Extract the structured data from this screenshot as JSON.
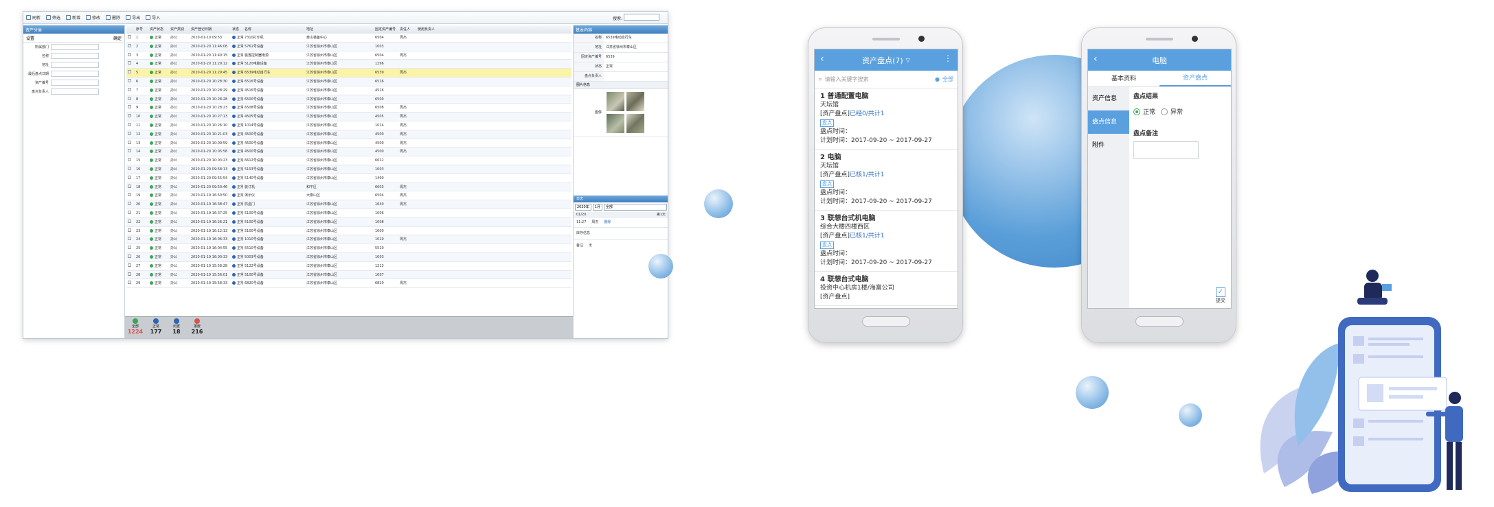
{
  "desktop": {
    "toolbar": [
      "刷新",
      "筛选",
      "新增",
      "修改",
      "删除",
      "导出",
      "导入"
    ],
    "search_label": "搜索:",
    "left_panel": {
      "title": "资产分类",
      "settings_label": "设置",
      "confirm_label": "确定",
      "fields": [
        "所属部门",
        "名称",
        "地址",
        "最后盘点日期",
        "资产编号",
        "盘点负责人"
      ]
    },
    "grid": {
      "headers": [
        "序号",
        "资产状态",
        "资产类别",
        "资产登记日期",
        "状态",
        "名称",
        "地址",
        "固定资产编号",
        "责任人",
        "使用负责人"
      ],
      "rows": [
        {
          "n": "1",
          "s": "正常",
          "c": "办公",
          "d": "2020-01-10 09:53",
          "st": "正常",
          "name": "7310打印机",
          "addr": "泰山装备中心",
          "code": "6504",
          "p": "周杰"
        },
        {
          "n": "2",
          "s": "正常",
          "c": "办公",
          "d": "2020-01-20 11:46:08",
          "st": "正常",
          "name": "5761号设备",
          "addr": "江苏省徐州市泰山区",
          "code": "1003",
          "p": ""
        },
        {
          "n": "3",
          "s": "正常",
          "c": "办公",
          "d": "2020-01-20 11:40:15",
          "st": "正常",
          "name": "装置控制器电源",
          "addr": "江苏省徐州市泰山区",
          "code": "6504",
          "p": "周杰"
        },
        {
          "n": "4",
          "s": "正常",
          "c": "办公",
          "d": "2020-01-20 11:29:12",
          "st": "正常",
          "name": "5120电脑设备",
          "addr": "江苏省徐州市泰山区",
          "code": "1296",
          "p": ""
        },
        {
          "n": "5",
          "s": "正常",
          "c": "办公",
          "d": "2020-01-20 11:29:45",
          "st": "正常",
          "name": "6539电动自行车",
          "addr": "江苏省徐州市泰山区",
          "code": "6539",
          "p": "周杰"
        },
        {
          "n": "6",
          "s": "正常",
          "c": "办公",
          "d": "2020-01-20 10:28:30",
          "st": "正常",
          "name": "6516号设备",
          "addr": "江苏省徐州市泰山区",
          "code": "6516",
          "p": ""
        },
        {
          "n": "7",
          "s": "正常",
          "c": "办公",
          "d": "2020-01-20 10:28:29",
          "st": "正常",
          "name": "4516号设备",
          "addr": "江苏省徐州市泰山区",
          "code": "4516",
          "p": ""
        },
        {
          "n": "8",
          "s": "正常",
          "c": "办公",
          "d": "2020-01-20 10:28:28",
          "st": "正常",
          "name": "6500号设备",
          "addr": "江苏省徐州市泰山区",
          "code": "6500",
          "p": ""
        },
        {
          "n": "9",
          "s": "正常",
          "c": "办公",
          "d": "2020-01-20 10:28:23",
          "st": "正常",
          "name": "6508号设备",
          "addr": "江苏省徐州市泰山区",
          "code": "6508",
          "p": "周杰"
        },
        {
          "n": "10",
          "s": "正常",
          "c": "办公",
          "d": "2020-01-20 10:27:13",
          "st": "正常",
          "name": "4505号设备",
          "addr": "江苏省徐州市泰山区",
          "code": "4505",
          "p": "周杰"
        },
        {
          "n": "11",
          "s": "正常",
          "c": "办公",
          "d": "2020-01-20 10:26:10",
          "st": "正常",
          "name": "1014号设备",
          "addr": "江苏省徐州市泰山区",
          "code": "1014",
          "p": "周杰"
        },
        {
          "n": "12",
          "s": "正常",
          "c": "办公",
          "d": "2020-01-20 10:21:03",
          "st": "正常",
          "name": "4500号设备",
          "addr": "江苏省徐州市泰山区",
          "code": "4500",
          "p": "周杰"
        },
        {
          "n": "13",
          "s": "正常",
          "c": "办公",
          "d": "2020-01-20 10:09:59",
          "st": "正常",
          "name": "4500号设备",
          "addr": "江苏省徐州市泰山区",
          "code": "4500",
          "p": "周杰"
        },
        {
          "n": "14",
          "s": "正常",
          "c": "办公",
          "d": "2020-01-20 10:05:58",
          "st": "正常",
          "name": "4500号设备",
          "addr": "江苏省徐州市泰山区",
          "code": "4500",
          "p": "周杰"
        },
        {
          "n": "15",
          "s": "正常",
          "c": "办公",
          "d": "2020-01-20 10:03:23",
          "st": "正常",
          "name": "6612号设备",
          "addr": "江苏省徐州市泰山区",
          "code": "6612",
          "p": ""
        },
        {
          "n": "16",
          "s": "正常",
          "c": "办公",
          "d": "2020-01-20 09:58:13",
          "st": "正常",
          "name": "5103号设备",
          "addr": "江苏省徐州市泰山区",
          "code": "1003",
          "p": ""
        },
        {
          "n": "17",
          "s": "正常",
          "c": "办公",
          "d": "2020-01-20 09:55:54",
          "st": "正常",
          "name": "5140号设备",
          "addr": "江苏省徐州市泰山区",
          "code": "1490",
          "p": ""
        },
        {
          "n": "18",
          "s": "正常",
          "c": "办公",
          "d": "2020-01-20 09:50:46",
          "st": "正常",
          "name": "装订机",
          "addr": "和平区",
          "code": "6603",
          "p": "周杰"
        },
        {
          "n": "19",
          "s": "正常",
          "c": "办公",
          "d": "2020-01-19 16:50:50",
          "st": "正常",
          "name": "演示仪",
          "addr": "大泰山区",
          "code": "6504",
          "p": "周杰"
        },
        {
          "n": "20",
          "s": "正常",
          "c": "办公",
          "d": "2020-01-19 16:38:47",
          "st": "正常",
          "name": "防盗门",
          "addr": "江苏省徐州市泰山区",
          "code": "1640",
          "p": "周杰"
        },
        {
          "n": "21",
          "s": "正常",
          "c": "办公",
          "d": "2020-01-19 16:37:25",
          "st": "正常",
          "name": "5100号设备",
          "addr": "江苏省徐州市泰山区",
          "code": "1006",
          "p": ""
        },
        {
          "n": "22",
          "s": "正常",
          "c": "办公",
          "d": "2020-01-19 16:26:21",
          "st": "正常",
          "name": "5100号设备",
          "addr": "江苏省徐州市泰山区",
          "code": "1008",
          "p": ""
        },
        {
          "n": "23",
          "s": "正常",
          "c": "办公",
          "d": "2020-01-19 16:12:13",
          "st": "正常",
          "name": "5100号设备",
          "addr": "江苏省徐州市泰山区",
          "code": "1000",
          "p": ""
        },
        {
          "n": "24",
          "s": "正常",
          "c": "办公",
          "d": "2020-01-19 16:06:33",
          "st": "正常",
          "name": "1010号设备",
          "addr": "江苏省徐州市泰山区",
          "code": "1010",
          "p": "周杰"
        },
        {
          "n": "25",
          "s": "正常",
          "c": "办公",
          "d": "2020-01-19 16:04:55",
          "st": "正常",
          "name": "5510号设备",
          "addr": "江苏省徐州市泰山区",
          "code": "5510",
          "p": ""
        },
        {
          "n": "26",
          "s": "正常",
          "c": "办公",
          "d": "2020-01-19 16:00:33",
          "st": "正常",
          "name": "5003号设备",
          "addr": "江苏省徐州市泰山区",
          "code": "1003",
          "p": ""
        },
        {
          "n": "27",
          "s": "正常",
          "c": "办公",
          "d": "2020-01-19 15:58:28",
          "st": "正常",
          "name": "5122号设备",
          "addr": "江苏省徐州市泰山区",
          "code": "1213",
          "p": ""
        },
        {
          "n": "28",
          "s": "正常",
          "c": "办公",
          "d": "2020-01-19 15:56:01",
          "st": "正常",
          "name": "5100号设备",
          "addr": "江苏省徐州市泰山区",
          "code": "1007",
          "p": ""
        },
        {
          "n": "29",
          "s": "正常",
          "c": "办公",
          "d": "2020-01-19 15:58:33",
          "st": "正常",
          "name": "6820号设备",
          "addr": "江苏省徐州市泰山区",
          "code": "6820",
          "p": "周杰"
        }
      ]
    },
    "right_panel": {
      "title": "基本内容",
      "items": [
        {
          "k": "名称",
          "v": "6539电动自行车"
        },
        {
          "k": "地址",
          "v": "江苏省徐州市泰山区"
        },
        {
          "k": "固定资产编号",
          "v": "6539"
        },
        {
          "k": "状态",
          "v": "正常"
        },
        {
          "k": "盘点负责人",
          "v": ""
        }
      ],
      "photo_section": "图片信息",
      "photo_label": "图像",
      "log_title": "日志",
      "log_year": "2020年",
      "log_month": "1月",
      "log_all": "全部",
      "log_date": "01/20",
      "log_day": "第1天",
      "log_time": "11:27",
      "log_user": "周杰",
      "log_action": "删除",
      "log_stock": "库存信息",
      "log_note_k": "备注",
      "log_note_v": "无"
    },
    "status": [
      {
        "label": "全部",
        "count": "1224",
        "color": "#3aa655"
      },
      {
        "label": "正常",
        "count": "177",
        "color": "#2f63b5"
      },
      {
        "label": "闲置",
        "count": "18",
        "color": "#2f63b5"
      },
      {
        "label": "报废",
        "count": "216",
        "color": "#d9534f"
      }
    ]
  },
  "phone1": {
    "title": "资产盘点(7)",
    "search_placeholder": "请输入关键字搜索",
    "search_all": "全部",
    "assets": [
      {
        "title": "1 普通配置电脑",
        "sub": "天坛馆",
        "status_k": "[资产盘点]",
        "status_v": "已经0/共计1",
        "tag": "盘点",
        "check": "盘点时间：",
        "plan": "计划时间：2017-09-20 ~ 2017-09-27"
      },
      {
        "title": "2 电脑",
        "sub": "天坛馆",
        "status_k": "[资产盘点]",
        "status_v": "已核1/共计1",
        "tag": "盘点",
        "check": "盘点时间：",
        "plan": "计划时间：2017-09-20 ~ 2017-09-27"
      },
      {
        "title": "3 联想台式机电脑",
        "sub": "综合大楼四楼西区",
        "status_k": "[资产盘点]",
        "status_v": "已核1/共计1",
        "tag": "盘点",
        "check": "盘点时间：",
        "plan": "计划时间：2017-09-20 ~ 2017-09-27"
      },
      {
        "title": "4 联想台式电脑",
        "sub": "投资中心机房1楼/海富公司",
        "status_k": "[资产盘点]",
        "status_v": "",
        "tag": "",
        "check": "",
        "plan": ""
      }
    ]
  },
  "phone2": {
    "title": "电脑",
    "tabs": [
      "基本资料",
      "资产盘点"
    ],
    "side": [
      "资产信息",
      "盘点信息",
      "附件"
    ],
    "result_title": "盘点结果",
    "opt_normal": "正常",
    "opt_abnormal": "异常",
    "note_title": "盘点备注",
    "submit": "提交"
  }
}
